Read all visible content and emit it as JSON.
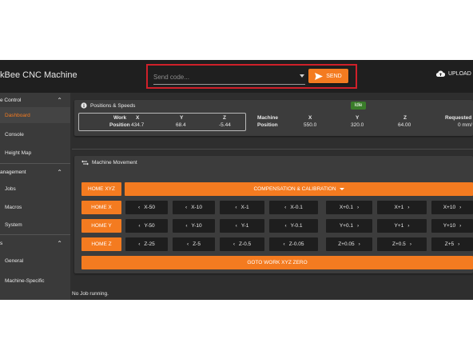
{
  "app": {
    "title": "kBee CNC Machine"
  },
  "send": {
    "placeholder": "Send code...",
    "button_label": "SEND"
  },
  "upload": {
    "label": "UPLOAD"
  },
  "sidebar": {
    "sections": [
      {
        "label": "e Control",
        "items": [
          "Dashboard",
          "Console",
          "Height Map"
        ]
      },
      {
        "label": "anagement",
        "items": [
          "Jobs",
          "Macros",
          "System"
        ]
      },
      {
        "label": "s",
        "items": [
          "General",
          "Machine-Specific"
        ]
      }
    ],
    "active_item": "Dashboard"
  },
  "positions": {
    "title": "Positions & Speeds",
    "status": "Idle",
    "work": {
      "label1": "Work",
      "label2": "Position",
      "x_label": "X",
      "y_label": "Y",
      "z_label": "Z",
      "x": "434.7",
      "y": "68.4",
      "z": "-5.44"
    },
    "machine": {
      "label1": "Machine",
      "label2": "Position",
      "x_label": "X",
      "y_label": "Y",
      "z_label": "Z",
      "x": "550.0",
      "y": "320.0",
      "z": "64.00"
    },
    "requested": {
      "label": "Requested",
      "value": "0 mm/"
    }
  },
  "movement": {
    "title": "Machine Movement",
    "home_xyz": "HOME XYZ",
    "compensation": "COMPENSATION & CALIBRATION",
    "home_x": "HOME X",
    "home_y": "HOME Y",
    "home_z": "HOME Z",
    "x_neg": [
      "X-50",
      "X-10",
      "X-1",
      "X-0.1"
    ],
    "x_pos": [
      "X+0.1",
      "X+1",
      "X+10"
    ],
    "y_neg": [
      "Y-50",
      "Y-10",
      "Y-1",
      "Y-0.1"
    ],
    "y_pos": [
      "Y+0.1",
      "Y+1",
      "Y+10"
    ],
    "z_neg": [
      "Z-25",
      "Z-5",
      "Z-0.5",
      "Z-0.05"
    ],
    "z_pos": [
      "Z+0.05",
      "Z+0.5",
      "Z+5"
    ],
    "goto_zero": "GOTO WORK XYZ ZERO"
  },
  "footer": {
    "status": "No Job running."
  },
  "colors": {
    "accent": "#f47b20",
    "highlight": "#d0202a",
    "idle": "#3a7d2a"
  }
}
